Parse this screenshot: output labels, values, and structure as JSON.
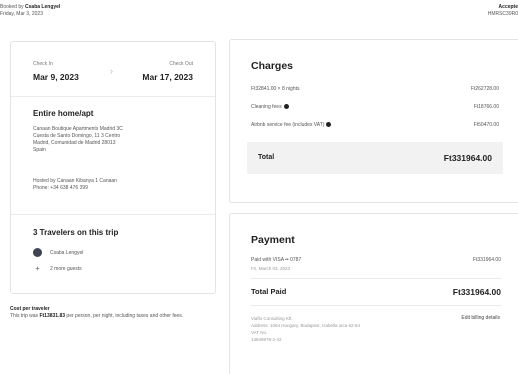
{
  "header": {
    "booked_prefix": "Booked by ",
    "booked_by": "Csaba Lengyel",
    "booked_date": "Friday, Mar 3, 2023",
    "status": "Accepte",
    "code": "HMRSC39R0"
  },
  "trip": {
    "checkin_label": "Check In",
    "checkin_date": "Mar 9, 2023",
    "checkout_label": "Check Out",
    "checkout_date": "Mar 17, 2023",
    "home_type": "Entire home/apt",
    "address": [
      "Canaan Boutique Apartments Madrid 3C",
      "Cuesta de Santo Domingo, 11 3 Centro",
      "Madrid, Comunidad de Madrid 28013",
      "Spain"
    ],
    "host": "Hosted by Canaan Kibanya 1 Canaan",
    "phone": "Phone: +34 638 476 399",
    "travelers_title": "3 Travelers on this trip",
    "traveler_name": "Csaba Lengyel",
    "more_guests": "2 more guests"
  },
  "cost": {
    "title": "Cost per traveler",
    "prefix": "This trip was ",
    "amount": "Ft13831.83",
    "suffix": " per person, per night, including taxes and other fees."
  },
  "charges": {
    "title": "Charges",
    "rows": [
      {
        "label": "Ft32841.00 × 8 nights",
        "value": "Ft262728.00"
      },
      {
        "label": "Cleaning fees",
        "value": "Ft18766.00"
      },
      {
        "label": "Airbnb service fee (includes VAT)",
        "value": "Ft50470.00"
      }
    ],
    "total_label": "Total",
    "total_value": "Ft331964.00"
  },
  "payment": {
    "title": "Payment",
    "method": "Paid with VISA •• 0787",
    "method_date": "Fri, March 03, 2023",
    "method_value": "Ft331964.00",
    "total_label": "Total Paid",
    "total_value": "Ft331964.00",
    "vendor": [
      "Viaflo Consulting Kft.",
      "Address: 1064 Hungary, Budapest, Izabella utca 62-64",
      "VAT No.",
      "13849976-2-42"
    ],
    "billing_link": "Edit billing details"
  },
  "colors": {
    "accent": "#222222",
    "muted": "#555555",
    "border": "#e3e3e3",
    "total_bg": "#f2f2f2"
  }
}
